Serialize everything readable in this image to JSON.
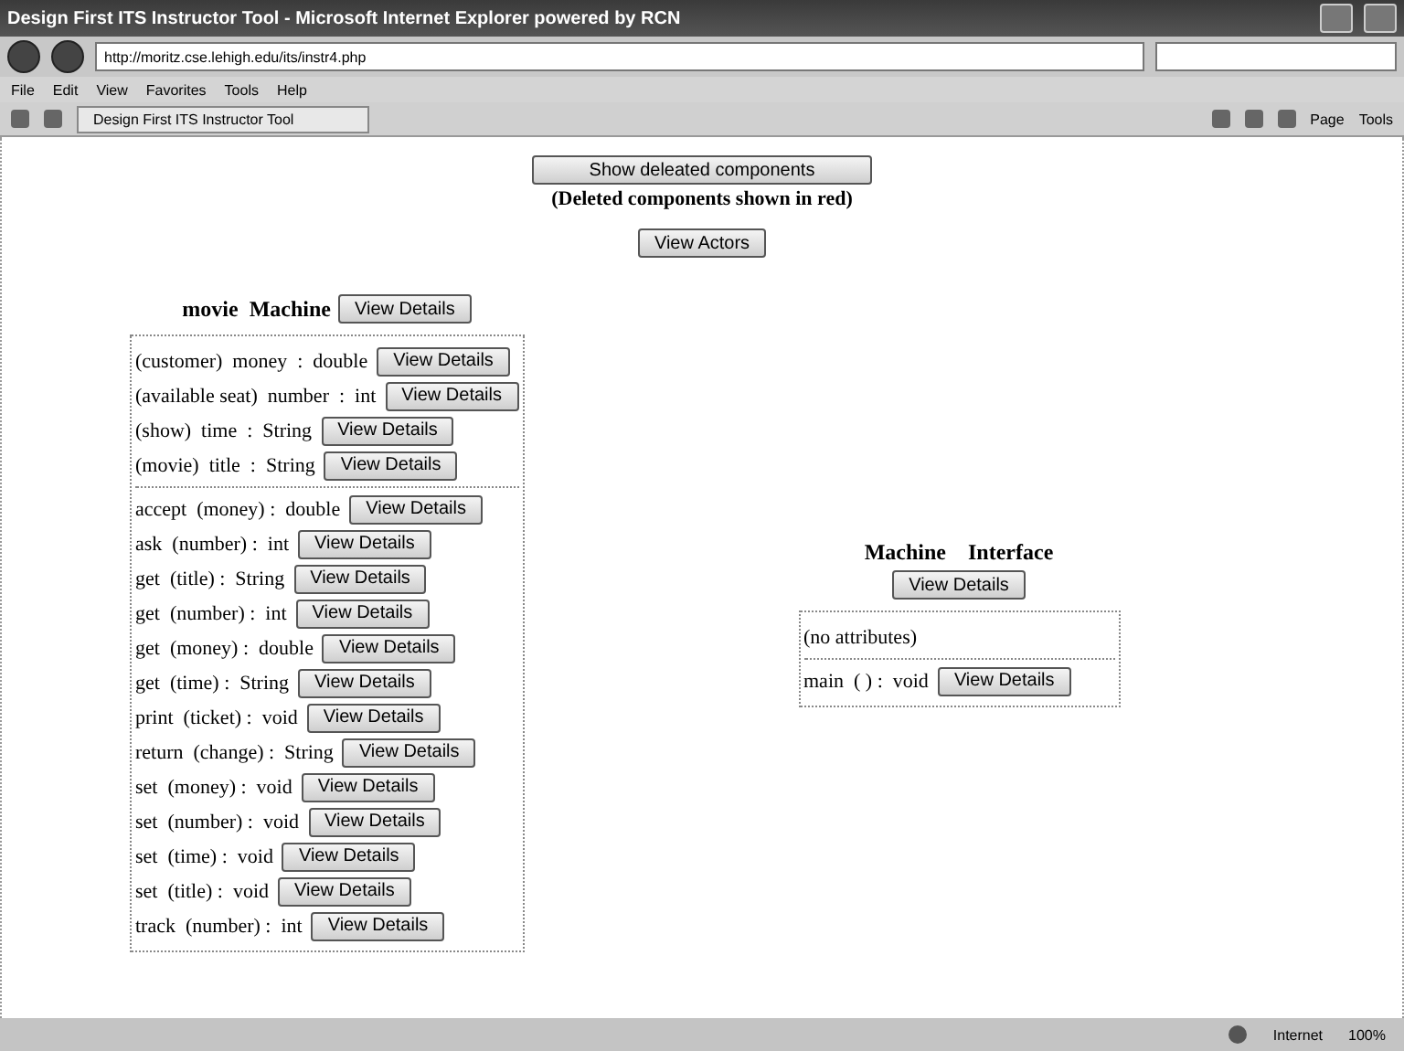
{
  "window": {
    "title": "Design First ITS Instructor Tool - Microsoft Internet Explorer powered by RCN"
  },
  "address_bar": {
    "url": "http://moritz.cse.lehigh.edu/its/instr4.php"
  },
  "menu_bar": [
    "File",
    "Edit",
    "View",
    "Favorites",
    "Tools",
    "Help"
  ],
  "tab": {
    "label": "Design First ITS Instructor Tool",
    "selected": true
  },
  "command_bar": [
    "Page",
    "Tools"
  ],
  "page": {
    "show_deleted_button": "Show deleated components",
    "note": "(Deleted components shown in red)",
    "actors_button": "View Actors",
    "classes": [
      {
        "name": "movie Machine",
        "button": "View Details",
        "attributes": [
          {
            "text": "(customer)  money  :  double",
            "button": "View Details"
          },
          {
            "text": "(available seat)  number  :  int",
            "button": "View Details"
          },
          {
            "text": "(show)  time  :  String",
            "button": "View Details"
          },
          {
            "text": "(movie)  title  :  String",
            "button": "View Details"
          }
        ],
        "methods": [
          {
            "text": "accept  (money) :  double",
            "button": "View Details"
          },
          {
            "text": "ask  (number) :  int",
            "button": "View Details"
          },
          {
            "text": "get  (title) :  String",
            "button": "View Details"
          },
          {
            "text": "get  (number) :  int",
            "button": "View Details"
          },
          {
            "text": "get  (money) :  double",
            "button": "View Details"
          },
          {
            "text": "get  (time) :  String",
            "button": "View Details"
          },
          {
            "text": "print  (ticket) :  void",
            "button": "View Details"
          },
          {
            "text": "return  (change) :  String",
            "button": "View Details"
          },
          {
            "text": "set  (money) :  void",
            "button": "View Details"
          },
          {
            "text": "set  (number) :  void",
            "button": "View Details"
          },
          {
            "text": "set  (time) :  void",
            "button": "View Details"
          },
          {
            "text": "set  (title) :  void",
            "button": "View Details"
          },
          {
            "text": "track  (number) :  int",
            "button": "View Details"
          }
        ]
      },
      {
        "name": "Machine  Interface",
        "button": "View Details",
        "no_attributes": "(no attributes)",
        "methods": [
          {
            "text": "main  ( ) :  void",
            "button": "View Details"
          }
        ]
      }
    ]
  },
  "status_bar": {
    "zone": "Internet",
    "zoom": "100%"
  }
}
